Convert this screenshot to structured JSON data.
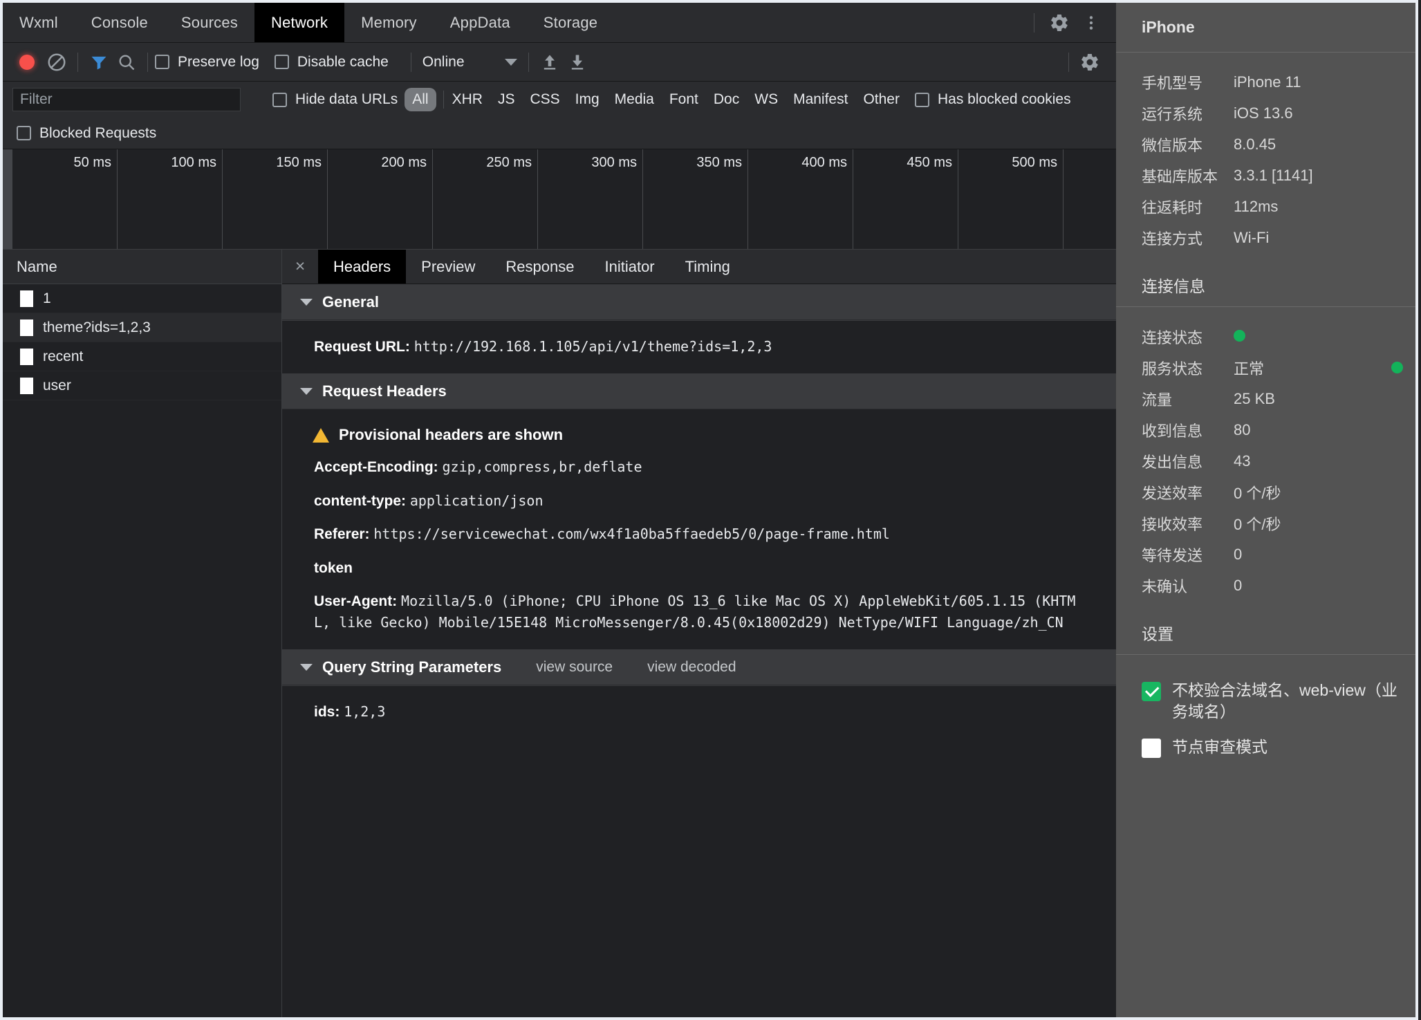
{
  "devtools": {
    "tabs": [
      {
        "label": "Wxml",
        "active": false
      },
      {
        "label": "Console",
        "active": false
      },
      {
        "label": "Sources",
        "active": false
      },
      {
        "label": "Network",
        "active": true
      },
      {
        "label": "Memory",
        "active": false
      },
      {
        "label": "AppData",
        "active": false
      },
      {
        "label": "Storage",
        "active": false
      }
    ],
    "toolbar": {
      "record_title": "record-button",
      "clear_title": "clear-button",
      "filter_title": "filter-button",
      "search_title": "search-button",
      "preserve_log": "Preserve log",
      "disable_cache": "Disable cache",
      "throttle": "Online",
      "import_har": "import-har",
      "export_har": "export-har",
      "settings": "network-settings"
    },
    "filterbar": {
      "placeholder": "Filter",
      "value": "",
      "hide_data_urls": "Hide data URLs",
      "types": [
        "All",
        "XHR",
        "JS",
        "CSS",
        "Img",
        "Media",
        "Font",
        "Doc",
        "WS",
        "Manifest",
        "Other"
      ],
      "active_type": "All",
      "has_blocked_cookies": "Has blocked cookies",
      "blocked_requests": "Blocked Requests"
    },
    "timeline": {
      "ticks": [
        "50 ms",
        "100 ms",
        "150 ms",
        "200 ms",
        "250 ms",
        "300 ms",
        "350 ms",
        "400 ms",
        "450 ms",
        "500 ms"
      ]
    },
    "requests": {
      "column_header": "Name",
      "rows": [
        {
          "name": "1",
          "selected": false
        },
        {
          "name": "theme?ids=1,2,3",
          "selected": true
        },
        {
          "name": "recent",
          "selected": false
        },
        {
          "name": "user",
          "selected": false
        }
      ]
    },
    "detail": {
      "close": "×",
      "tabs": [
        {
          "label": "Headers",
          "active": true
        },
        {
          "label": "Preview",
          "active": false
        },
        {
          "label": "Response",
          "active": false
        },
        {
          "label": "Initiator",
          "active": false
        },
        {
          "label": "Timing",
          "active": false
        }
      ],
      "general": {
        "title": "General",
        "request_url_key": "Request URL:",
        "request_url_value": "http://192.168.1.105/api/v1/theme?ids=1,2,3"
      },
      "request_headers": {
        "title": "Request Headers",
        "warning": "Provisional headers are shown",
        "items": [
          {
            "key": "Accept-Encoding:",
            "value": "gzip,compress,br,deflate"
          },
          {
            "key": "content-type:",
            "value": "application/json"
          },
          {
            "key": "Referer:",
            "value": "https://servicewechat.com/wx4f1a0ba5ffaedeb5/0/page-frame.html"
          },
          {
            "key": "token",
            "value": ""
          },
          {
            "key": "User-Agent:",
            "value": "Mozilla/5.0 (iPhone; CPU iPhone OS 13_6 like Mac OS X) AppleWebKit/605.1.15 (KHTML, like Gecko) Mobile/15E148 MicroMessenger/8.0.45(0x18002d29) NetType/WIFI Language/zh_CN"
          }
        ]
      },
      "query_string": {
        "title": "Query String Parameters",
        "view_source": "view source",
        "view_decoded": "view decoded",
        "items": [
          {
            "key": "ids:",
            "value": "1,2,3"
          }
        ]
      }
    }
  },
  "right_panel": {
    "title": "iPhone",
    "device_info": [
      {
        "label": "手机型号",
        "value": "iPhone 11"
      },
      {
        "label": "运行系统",
        "value": "iOS 13.6"
      },
      {
        "label": "微信版本",
        "value": "8.0.45"
      },
      {
        "label": "基础库版本",
        "value": "3.3.1 [1141]"
      },
      {
        "label": "往返耗时",
        "value": "112ms"
      },
      {
        "label": "连接方式",
        "value": "Wi-Fi"
      }
    ],
    "connection_title": "连接信息",
    "connection_info": [
      {
        "label": "连接状态",
        "value": "",
        "dot": true,
        "right_dot": false
      },
      {
        "label": "服务状态",
        "value": "正常",
        "dot": false,
        "right_dot": true
      },
      {
        "label": "流量",
        "value": "25 KB",
        "dot": false,
        "right_dot": false
      },
      {
        "label": "收到信息",
        "value": "80",
        "dot": false,
        "right_dot": false
      },
      {
        "label": "发出信息",
        "value": "43",
        "dot": false,
        "right_dot": false
      },
      {
        "label": "发送效率",
        "value": "0 个/秒",
        "dot": false,
        "right_dot": false
      },
      {
        "label": "接收效率",
        "value": "0 个/秒",
        "dot": false,
        "right_dot": false
      },
      {
        "label": "等待发送",
        "value": "0",
        "dot": false,
        "right_dot": false
      },
      {
        "label": "未确认",
        "value": "0",
        "dot": false,
        "right_dot": false
      }
    ],
    "settings_title": "设置",
    "settings": [
      {
        "label": "不校验合法域名、web-view（业务域名）",
        "checked": true
      },
      {
        "label": "节点审查模式",
        "checked": false
      }
    ],
    "colors": {
      "status_green": "#13b35a",
      "checkbox_green": "#18b661",
      "panel_bg": "#535353"
    }
  }
}
